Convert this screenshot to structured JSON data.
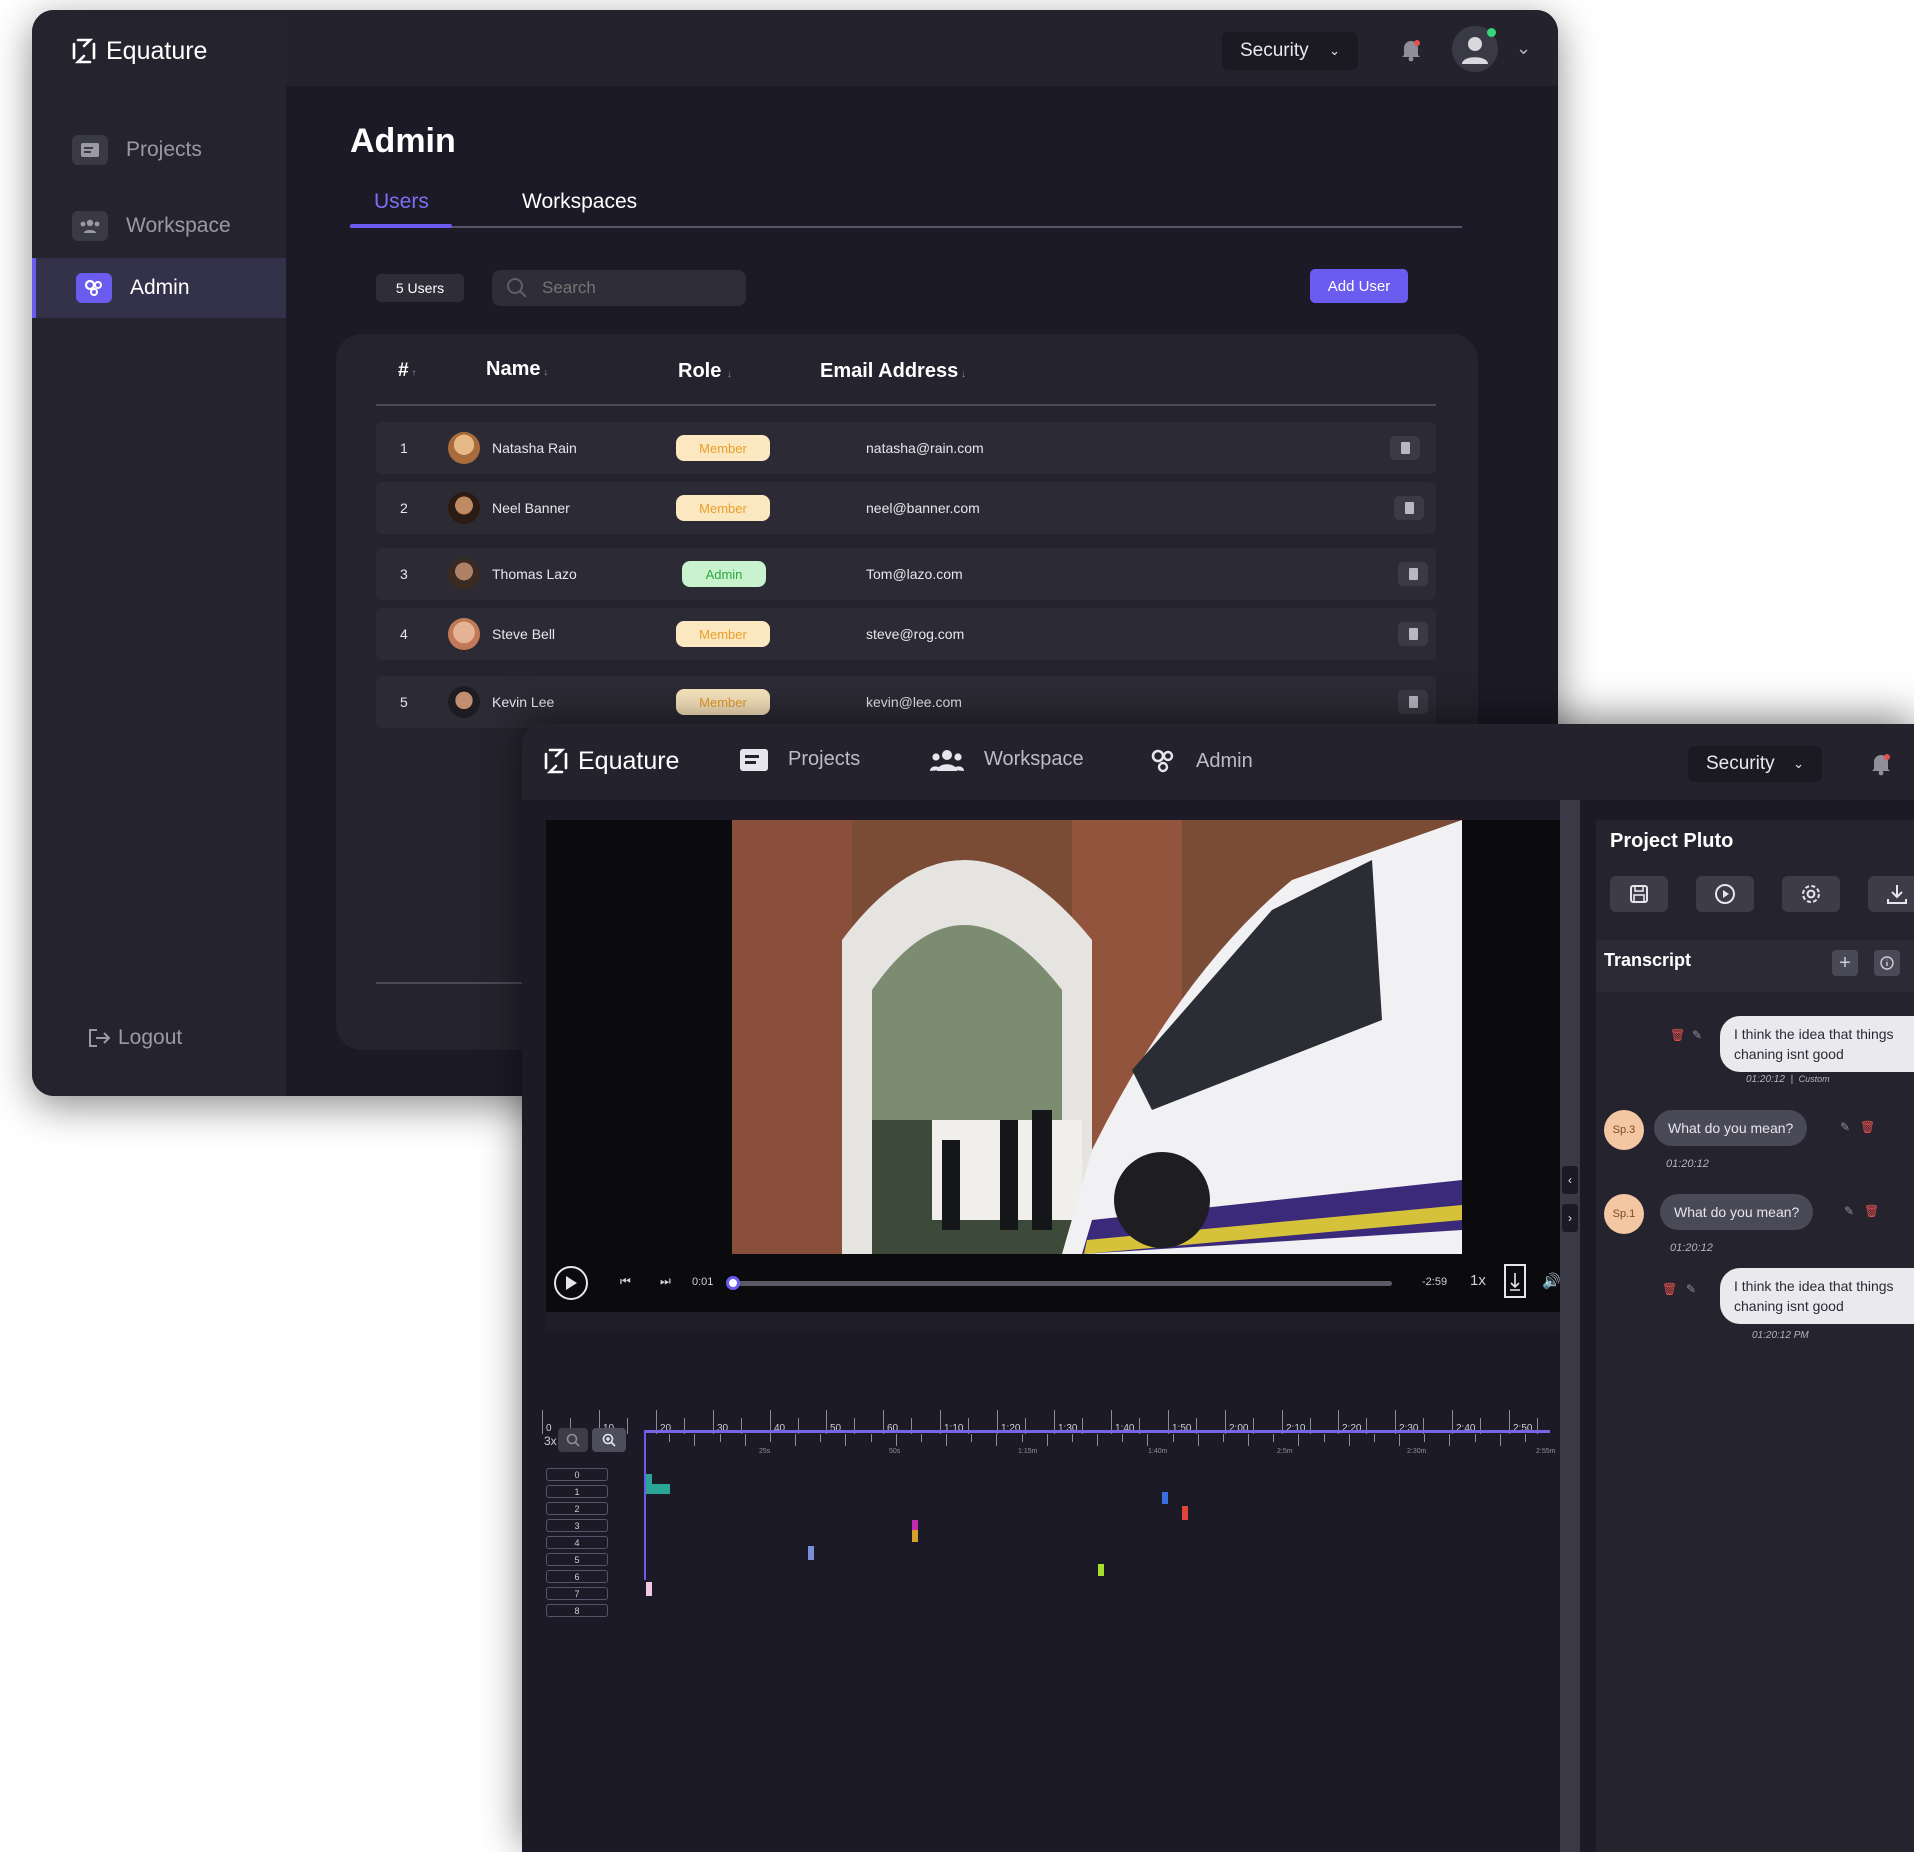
{
  "window1": {
    "logo": "Equature",
    "security_label": "Security",
    "nav": [
      {
        "label": "Projects"
      },
      {
        "label": "Workspace"
      },
      {
        "label": "Admin"
      }
    ],
    "logout_label": "Logout",
    "page_title": "Admin",
    "tabs": [
      {
        "label": "Users"
      },
      {
        "label": "Workspaces"
      }
    ],
    "users_count": "5 Users",
    "search_placeholder": "Search",
    "add_user_label": "Add User",
    "columns": [
      "#",
      "Name",
      "Role",
      "Email Address"
    ],
    "rows": [
      {
        "num": "1",
        "name": "Natasha Rain",
        "role": "Member",
        "email": "natasha@rain.com"
      },
      {
        "num": "2",
        "name": "Neel Banner",
        "role": "Member",
        "email": "neel@banner.com"
      },
      {
        "num": "3",
        "name": "Thomas Lazo",
        "role": "Admin",
        "email": "Tom@lazo.com"
      },
      {
        "num": "4",
        "name": "Steve Bell",
        "role": "Member",
        "email": "steve@rog.com"
      },
      {
        "num": "5",
        "name": "Kevin Lee",
        "role": "Member",
        "email": "kevin@lee.com"
      }
    ]
  },
  "window2": {
    "logo": "Equature",
    "nav": [
      {
        "label": "Projects"
      },
      {
        "label": "Workspace"
      },
      {
        "label": "Admin"
      }
    ],
    "security_label": "Security",
    "player": {
      "current_time": "0:01",
      "remaining_time": "-2:59",
      "speed": "1x"
    },
    "ruler_labels": [
      "0",
      "10",
      "20",
      "30",
      "40",
      "50",
      "60",
      "1:10",
      "1:20",
      "1:30",
      "1:40",
      "1:50",
      "2:00",
      "2:10",
      "2:20",
      "2:30",
      "2:40",
      "2:50"
    ],
    "zoom_level": "3x",
    "minor_labels": [
      "25s",
      "50s",
      "1:15m",
      "1:40m",
      "2:5m",
      "2:30m",
      "2:55m"
    ],
    "lanes": [
      "0",
      "1",
      "2",
      "3",
      "4",
      "5",
      "6",
      "7",
      "8"
    ],
    "project_title": "Project Pluto",
    "transcript_label": "Transcript",
    "messages": [
      {
        "text": "I think the idea that things chaning isnt good",
        "time": "01:20:12",
        "tag": "Custom"
      },
      {
        "speaker": "Sp.3",
        "text": "What do you mean?",
        "time": "01:20:12"
      },
      {
        "speaker": "Sp.1",
        "text": "What do you mean?",
        "time": "01:20:12"
      },
      {
        "text": "I think the idea that things chaning isnt good",
        "time": "01:20:12 PM"
      }
    ]
  },
  "colors": {
    "accent": "#6b5cf0",
    "bg": "#1c1a26",
    "panel": "#25242e"
  }
}
